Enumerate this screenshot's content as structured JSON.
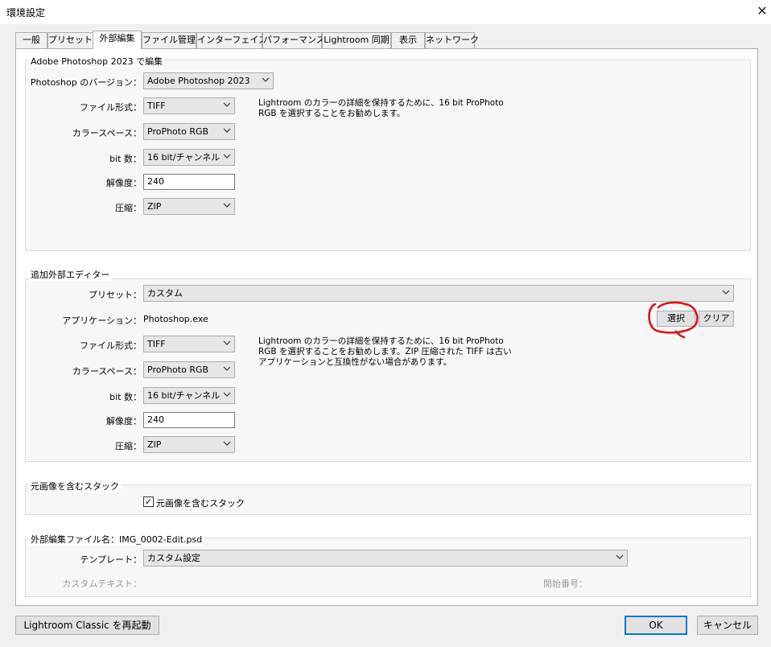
{
  "window": {
    "title": "環境設定",
    "close_glyph": "✕"
  },
  "tabs": [
    {
      "label": "一般"
    },
    {
      "label": "プリセット"
    },
    {
      "label": "外部編集",
      "active": true
    },
    {
      "label": "ファイル管理"
    },
    {
      "label": "インターフェイス"
    },
    {
      "label": "パフォーマンス"
    },
    {
      "label": "Lightroom 同期"
    },
    {
      "label": "表示"
    },
    {
      "label": "ネットワーク"
    }
  ],
  "ps_group": {
    "title": "Adobe Photoshop 2023 で編集",
    "version_label": "Photoshop のバージョン：",
    "version_value": "Adobe Photoshop 2023",
    "format_label": "ファイル形式：",
    "format_value": "TIFF",
    "colorspace_label": "カラースペース：",
    "colorspace_value": "ProPhoto RGB",
    "bitdepth_label": "bit 数：",
    "bitdepth_value": "16 bit/チャンネル",
    "resolution_label": "解像度：",
    "resolution_value": "240",
    "compression_label": "圧縮：",
    "compression_value": "ZIP",
    "note_line1": "Lightroom のカラーの詳細を保持するために、16 bit ProPhoto",
    "note_line2": "RGB を選択することをお勧めします。"
  },
  "extra_group": {
    "title": "追加外部エディター",
    "preset_label": "プリセット：",
    "preset_value": "カスタム",
    "app_label": "アプリケーション：",
    "app_value": "Photoshop.exe",
    "choose_button": "選択",
    "clear_button": "クリア",
    "format_label": "ファイル形式：",
    "format_value": "TIFF",
    "colorspace_label": "カラースペース：",
    "colorspace_value": "ProPhoto RGB",
    "bitdepth_label": "bit 数：",
    "bitdepth_value": "16 bit/チャンネル",
    "resolution_label": "解像度：",
    "resolution_value": "240",
    "compression_label": "圧縮：",
    "compression_value": "ZIP",
    "note_line1": "Lightroom のカラーの詳細を保持するために、16 bit ProPhoto",
    "note_line2": "RGB を選択することをお勧めします。ZIP 圧縮された TIFF は古い",
    "note_line3": "アプリケーションと互換性がない場合があります。"
  },
  "stack_group": {
    "title": "元画像を含むスタック",
    "checkbox_label": "元画像を含むスタック",
    "checked": true,
    "check_glyph": "✓"
  },
  "naming_group": {
    "title": "外部編集ファイル名：IMG_0002-Edit.psd",
    "template_label": "テンプレート：",
    "template_value": "カスタム設定",
    "custom_text_label": "カスタムテキスト：",
    "start_number_label": "開始番号："
  },
  "footer": {
    "restart_button": "Lightroom Classic を再起動",
    "ok_button": "OK",
    "cancel_button": "キャンセル"
  },
  "annotation": {
    "color": "#e0101a"
  },
  "colors": {
    "focus_blue": "#0078d7"
  }
}
